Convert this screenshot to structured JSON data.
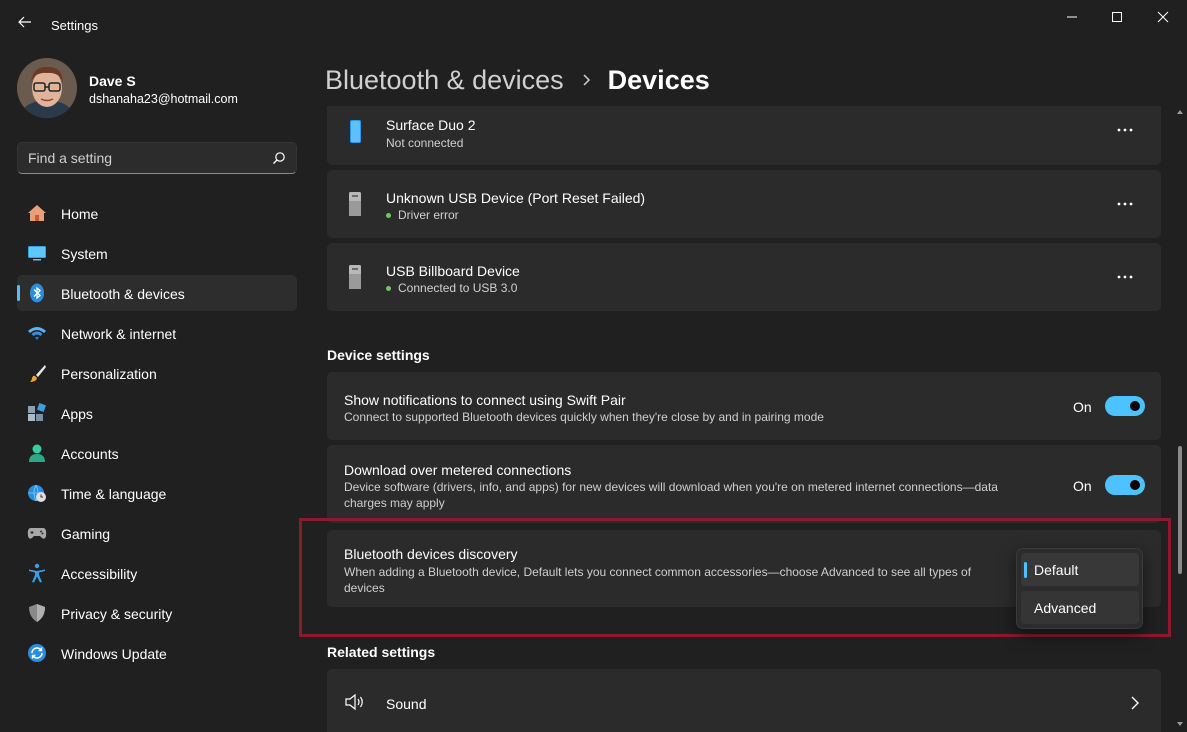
{
  "window": {
    "title": "Settings"
  },
  "profile": {
    "name": "Dave S",
    "email": "dshanaha23@hotmail.com"
  },
  "search": {
    "placeholder": "Find a setting"
  },
  "nav": {
    "items": [
      {
        "label": "Home",
        "icon": "home-icon"
      },
      {
        "label": "System",
        "icon": "system-icon"
      },
      {
        "label": "Bluetooth & devices",
        "icon": "bluetooth-icon",
        "selected": true
      },
      {
        "label": "Network & internet",
        "icon": "wifi-icon"
      },
      {
        "label": "Personalization",
        "icon": "brush-icon"
      },
      {
        "label": "Apps",
        "icon": "apps-icon"
      },
      {
        "label": "Accounts",
        "icon": "accounts-icon"
      },
      {
        "label": "Time & language",
        "icon": "globe-clock-icon"
      },
      {
        "label": "Gaming",
        "icon": "gamepad-icon"
      },
      {
        "label": "Accessibility",
        "icon": "accessibility-icon"
      },
      {
        "label": "Privacy & security",
        "icon": "shield-icon"
      },
      {
        "label": "Windows Update",
        "icon": "update-icon"
      }
    ]
  },
  "breadcrumb": {
    "parent": "Bluetooth & devices",
    "current": "Devices"
  },
  "devices": [
    {
      "name": "Surface Duo 2",
      "status": "Not connected",
      "status_dot": false,
      "icon": "phone-icon"
    },
    {
      "name": "Unknown USB Device (Port Reset Failed)",
      "status": "Driver error",
      "status_dot": true,
      "icon": "usb-device-icon"
    },
    {
      "name": "USB Billboard Device",
      "status": "Connected to USB 3.0",
      "status_dot": true,
      "icon": "usb-device-icon"
    }
  ],
  "device_settings": {
    "section_title": "Device settings",
    "swift_pair": {
      "title": "Show notifications to connect using Swift Pair",
      "desc": "Connect to supported Bluetooth devices quickly when they're close by and in pairing mode",
      "state_label": "On",
      "on": true
    },
    "metered": {
      "title": "Download over metered connections",
      "desc_line1": "Device software (drivers, info, and apps) for new devices will download when you're on metered internet connections—data",
      "desc_line2": "charges may apply",
      "state_label": "On",
      "on": true
    },
    "discovery": {
      "title": "Bluetooth devices discovery",
      "desc_line1": "When adding a Bluetooth device, Default lets you connect common accessories—choose Advanced to see all types of",
      "desc_line2": "devices",
      "options": [
        "Default",
        "Advanced"
      ],
      "selected": "Default"
    }
  },
  "related_settings": {
    "section_title": "Related settings",
    "items": [
      {
        "label": "Sound",
        "icon": "speaker-icon"
      }
    ]
  },
  "colors": {
    "accent": "#4cc2ff",
    "highlight_border": "#8b1a2b",
    "status_green": "#6ccb5f",
    "background": "#202020",
    "card": "#2b2b2b"
  }
}
